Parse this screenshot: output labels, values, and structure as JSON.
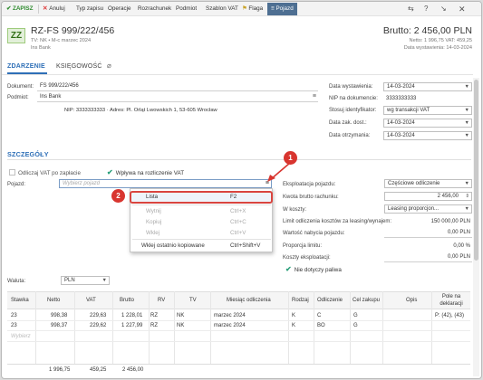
{
  "toolbar": {
    "save": "ZAPISZ",
    "cancel": "Anuluj",
    "type": "Typ zapisu",
    "operations": "Operacje",
    "settlement": "Rozrachunek",
    "entity": "Podmiot",
    "vat_template": "Szablon VAT",
    "flag": "Flaga",
    "vehicle": "Pojazd"
  },
  "header": {
    "badge": "ZZ",
    "title": "RZ-FS 999/222/456",
    "subtitle": "TV: NK • M-c marzec 2024",
    "company": "Ins Bank",
    "brutto": "Brutto: 2 456,00 PLN",
    "netto_line": "Netto: 1 996,75 VAT: 459,25",
    "date_line": "Data wystawienia: 14-03-2024"
  },
  "tabs": [
    "ZDARZENIE",
    "KSIĘGOWOŚĆ"
  ],
  "event": {
    "document_label": "Dokument:",
    "document_value": "FS 999/222/456",
    "entity_label": "Podmiot:",
    "entity_value": "Ins Bank",
    "nip_address": "NIP: 3333333333  ·  Adres: Pl. Orląt Lwowskich 1, 53-605 Wrocław",
    "issue_date_label": "Data wystawienia:",
    "issue_date_value": "14-03-2024",
    "nip_doc_label": "NIP na dokumencie:",
    "nip_doc_value": "3333333333",
    "identifier_label": "Stosuj identyfikator:",
    "identifier_value": "wg transakcji VAT",
    "tax_date_label": "Data zak. dost.:",
    "tax_date_value": "14-03-2024",
    "receipt_date_label": "Data otrzymania:",
    "receipt_date_value": "14-03-2024"
  },
  "details": {
    "section_title": "SZCZEGÓŁY",
    "vat_after_payment": "Odliczaj VAT po zapłacie",
    "affects_vat": "Wpływa na rozliczenie VAT",
    "vehicle_label": "Pojazd:",
    "vehicle_placeholder": "Wybierz pojazd",
    "usage_label": "Eksploatacja pojazdu:",
    "usage_value": "Częściowe odliczenie",
    "gross_amount_label": "Kwota brutto rachunku:",
    "gross_amount_value": "2 456,00",
    "costs_label": "W koszty:",
    "costs_value": "Leasing proporcjon...",
    "limit_label": "Limit odliczenia kosztów za leasing/wynajem:",
    "limit_value": "150 000,00 PLN",
    "purchase_value_label": "Wartość nabycia pojazdu:",
    "purchase_value": "0,00 PLN",
    "proportion_label": "Proporcja limitu:",
    "proportion_value": "0,00 %",
    "costs_usage_label": "Koszty eksploatacji:",
    "costs_usage_value": "0,00 PLN",
    "not_fuel": "Nie dotyczy paliwa"
  },
  "menu": {
    "items": [
      {
        "label": "Lista",
        "shortcut": "F2",
        "enabled": true
      },
      {
        "label": "Wytnij",
        "shortcut": "Ctrl+X",
        "enabled": false
      },
      {
        "label": "Kopiuj",
        "shortcut": "Ctrl+C",
        "enabled": false
      },
      {
        "label": "Wklej",
        "shortcut": "Ctrl+V",
        "enabled": false
      },
      {
        "label": "Wklej ostatnio kopiowane",
        "shortcut": "Ctrl+Shift+V",
        "enabled": true
      }
    ]
  },
  "annotations": {
    "step1": "1",
    "step2": "2"
  },
  "currency": {
    "label": "Waluta:",
    "value": "PLN"
  },
  "table": {
    "headers": [
      "Stawka",
      "Netto",
      "VAT",
      "Brutto",
      "RV",
      "TV",
      "Miesiąc odliczenia",
      "Rodzaj",
      "Odliczenie",
      "Cel zakupu",
      "Opis",
      "Pole na deklaracji"
    ],
    "rows": [
      [
        "23",
        "998,38",
        "229,63",
        "1 228,01",
        "RZ",
        "NK",
        "marzec 2024",
        "K",
        "C",
        "G",
        "",
        "P: (42), (43)"
      ],
      [
        "23",
        "998,37",
        "229,62",
        "1 227,99",
        "RZ",
        "NK",
        "marzec 2024",
        "K",
        "BO",
        "G",
        "",
        ""
      ]
    ],
    "new_row_placeholder": "Wybierz",
    "totals": {
      "netto": "1 996,75",
      "vat": "459,25",
      "brutto": "2 456,00"
    }
  },
  "colors": {
    "accent": "#2e6fb7",
    "save": "#2e8b2e",
    "marker": "#d8352f",
    "active_tab_bg": "#4e6f92"
  }
}
